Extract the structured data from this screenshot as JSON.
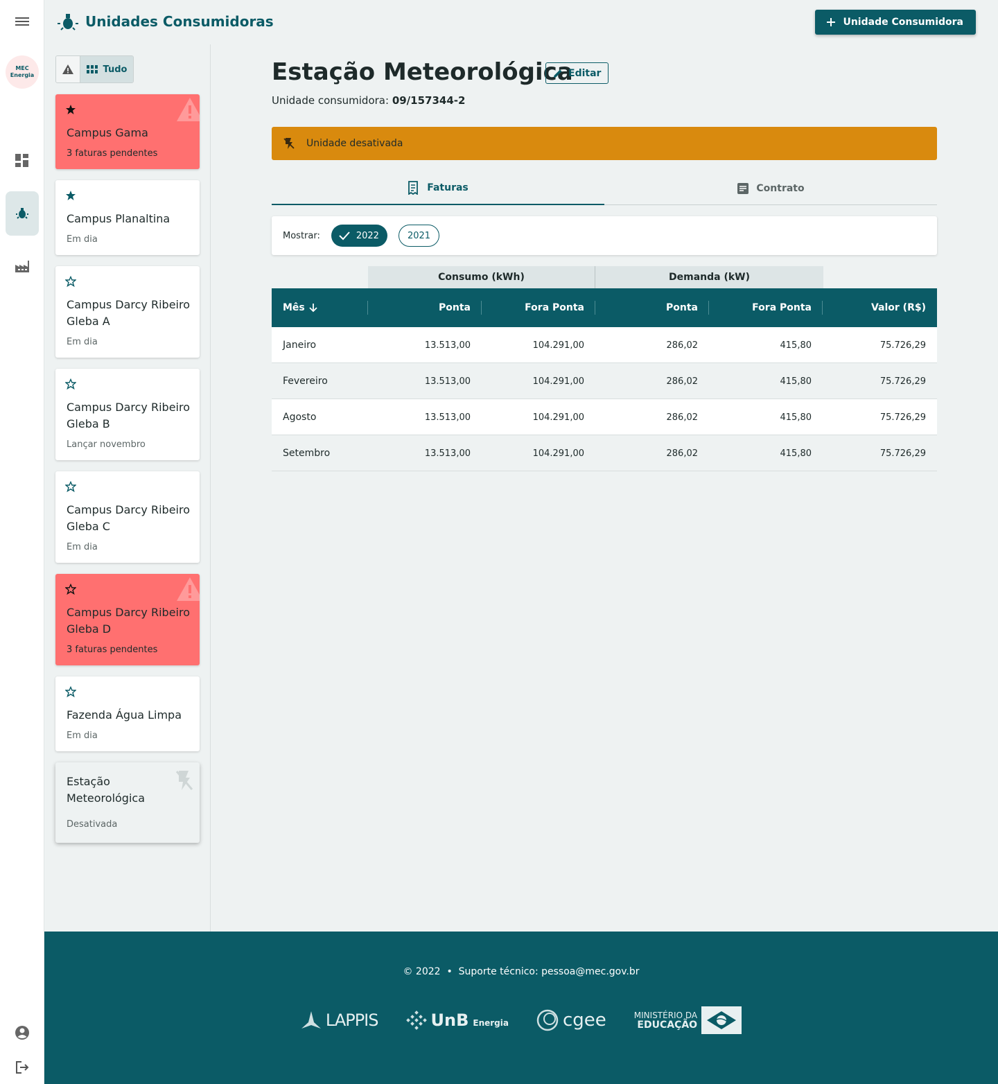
{
  "app": {
    "logo_line1": "MEC",
    "logo_line2": "Energia",
    "page_title": "Unidades Consumidoras",
    "add_button": "Unidade Consumidora"
  },
  "rail": {
    "icons": [
      "menu-icon",
      "dashboard-icon",
      "lightbulb-icon",
      "factory-icon",
      "account-icon",
      "logout-icon"
    ]
  },
  "filter": {
    "all_label": "Tudo"
  },
  "units": [
    {
      "name": "Campus Gama",
      "status": "3 faturas pendentes",
      "favorite": true,
      "state": "alert"
    },
    {
      "name": "Campus Planaltina",
      "status": "Em dia",
      "favorite": true,
      "state": "ok"
    },
    {
      "name": "Campus Darcy Ribeiro Gleba A",
      "status": "Em dia",
      "favorite": false,
      "state": "ok"
    },
    {
      "name": "Campus Darcy Ribeiro Gleba B",
      "status": "Lançar novembro",
      "favorite": false,
      "state": "ok"
    },
    {
      "name": "Campus Darcy Ribeiro Gleba C",
      "status": "Em dia",
      "favorite": false,
      "state": "ok"
    },
    {
      "name": "Campus Darcy Ribeiro Gleba D",
      "status": "3 faturas pendentes",
      "favorite": false,
      "state": "alert"
    },
    {
      "name": "Fazenda Água Limpa",
      "status": "Em dia",
      "favorite": false,
      "state": "ok"
    },
    {
      "name": "Estação Meteorológica",
      "status": "Desativada",
      "favorite": false,
      "state": "off"
    }
  ],
  "detail": {
    "title": "Estação Meteorológica",
    "edit_label": "Editar",
    "uc_label": "Unidade consumidora:",
    "uc_number": "09/157344-2",
    "banner": "Unidade desativada",
    "tabs": [
      "Faturas",
      "Contrato"
    ],
    "show_label": "Mostrar:",
    "years": [
      "2022",
      "2021"
    ],
    "selected_year": "2022"
  },
  "table": {
    "groups": [
      "Consumo (kWh)",
      "Demanda (kW)"
    ],
    "headers": [
      "Mês",
      "Ponta",
      "Fora Ponta",
      "Ponta",
      "Fora Ponta",
      "Valor (R$)"
    ],
    "rows": [
      [
        "Janeiro",
        "13.513,00",
        "104.291,00",
        "286,02",
        "415,80",
        "75.726,29"
      ],
      [
        "Fevereiro",
        "13.513,00",
        "104.291,00",
        "286,02",
        "415,80",
        "75.726,29"
      ],
      [
        "Agosto",
        "13.513,00",
        "104.291,00",
        "286,02",
        "415,80",
        "75.726,29"
      ],
      [
        "Setembro",
        "13.513,00",
        "104.291,00",
        "286,02",
        "415,80",
        "75.726,29"
      ]
    ]
  },
  "footer": {
    "copyright": "© 2022",
    "support_label": "Suporte técnico:",
    "support_email": "pessoa@mec.gov.br",
    "logo_lappis": "LAPPIS",
    "logo_unb": "UnB",
    "logo_unb_sub": "Energia",
    "logo_cgee": "cgee",
    "logo_mec_line1": "MINISTÉRIO DA",
    "logo_mec_line2": "EDUCAÇÃO"
  },
  "colors": {
    "primary": "#0b5b66",
    "alert": "#ff7070",
    "warning": "#d98a0e",
    "background": "#eef2f2"
  }
}
